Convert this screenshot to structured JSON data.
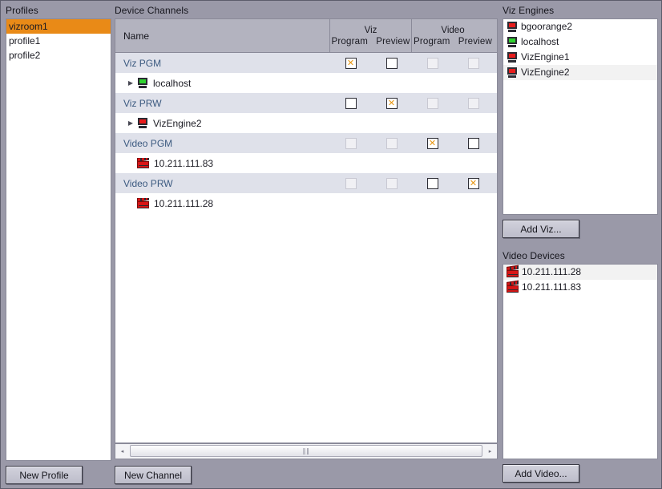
{
  "profiles": {
    "label": "Profiles",
    "items": [
      {
        "name": "vizroom1",
        "selected": true
      },
      {
        "name": "profile1",
        "selected": false
      },
      {
        "name": "profile2",
        "selected": false
      }
    ],
    "new_button": "New Profile"
  },
  "device_channels": {
    "label": "Device Channels",
    "new_button": "New Channel",
    "columns": {
      "name": "Name",
      "viz": {
        "title": "Viz",
        "sub1": "Program",
        "sub2": "Preview"
      },
      "video": {
        "title": "Video",
        "sub1": "Program",
        "sub2": "Preview"
      }
    },
    "rows": [
      {
        "type": "group",
        "label": "Viz PGM",
        "viz_program": "checked",
        "viz_preview": "unchecked",
        "video_program": "disabled",
        "video_preview": "disabled"
      },
      {
        "type": "leaf",
        "label": "localhost",
        "icon": "monitor-green-icon",
        "expandable": true
      },
      {
        "type": "group",
        "label": "Viz PRW",
        "viz_program": "unchecked",
        "viz_preview": "checked",
        "video_program": "disabled",
        "video_preview": "disabled"
      },
      {
        "type": "leaf",
        "label": "VizEngine2",
        "icon": "monitor-red-icon",
        "expandable": true
      },
      {
        "type": "group",
        "label": "Video PGM",
        "viz_program": "disabled",
        "viz_preview": "disabled",
        "video_program": "checked",
        "video_preview": "unchecked"
      },
      {
        "type": "leaf",
        "label": "10.211.111.83",
        "icon": "clapperboard-icon",
        "expandable": false
      },
      {
        "type": "group",
        "label": "Video PRW",
        "viz_program": "disabled",
        "viz_preview": "disabled",
        "video_program": "unchecked",
        "video_preview": "checked"
      },
      {
        "type": "leaf",
        "label": "10.211.111.28",
        "icon": "clapperboard-icon",
        "expandable": false
      }
    ],
    "scrollbar": {
      "left_arrow": "◂",
      "right_arrow": "▸",
      "grip": "‖‖"
    }
  },
  "viz_engines": {
    "label": "Viz Engines",
    "items": [
      {
        "name": "bgoorange2",
        "icon": "monitor-red-icon",
        "selected": false
      },
      {
        "name": "localhost",
        "icon": "monitor-green-icon",
        "selected": false
      },
      {
        "name": "VizEngine1",
        "icon": "monitor-red-icon",
        "selected": false
      },
      {
        "name": "VizEngine2",
        "icon": "monitor-red-icon",
        "selected": true
      }
    ],
    "add_button": "Add Viz..."
  },
  "video_devices": {
    "label": "Video Devices",
    "items": [
      {
        "name": "10.211.111.28",
        "icon": "clapperboard-icon",
        "selected": true
      },
      {
        "name": "10.211.111.83",
        "icon": "clapperboard-icon",
        "selected": false
      }
    ],
    "add_button": "Add Video..."
  },
  "colors": {
    "background": "#9a99a8",
    "selection_orange": "#e98a17",
    "checkbox_mark": "#e8950f",
    "group_row": "#dfe1ea",
    "group_text": "#3c5a80",
    "header": "#b3b3bf"
  }
}
